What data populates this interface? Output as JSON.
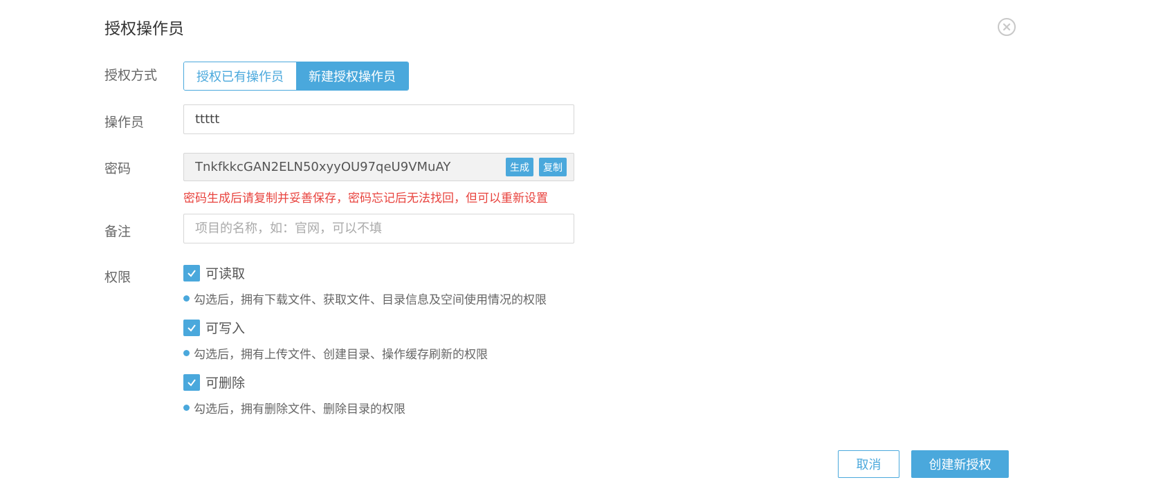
{
  "dialog": {
    "title": "授权操作员",
    "close_icon": "close-circle-icon"
  },
  "auth_mode": {
    "label": "授权方式",
    "options": [
      "授权已有操作员",
      "新建授权操作员"
    ],
    "selected": "新建授权操作员"
  },
  "operator": {
    "label": "操作员",
    "value": "ttttt"
  },
  "password": {
    "label": "密码",
    "value": "TnkfkkcGAN2ELN50xyyOU97qeU9VMuAY",
    "generate_label": "生成",
    "copy_label": "复制",
    "warning": "密码生成后请复制并妥善保存，密码忘记后无法找回，但可以重新设置"
  },
  "remark": {
    "label": "备注",
    "placeholder": "项目的名称，如：官网，可以不填",
    "value": ""
  },
  "permissions": {
    "label": "权限",
    "items": [
      {
        "label": "可读取",
        "checked": true,
        "hint": "勾选后，拥有下载文件、获取文件、目录信息及空间使用情况的权限"
      },
      {
        "label": "可写入",
        "checked": true,
        "hint": "勾选后，拥有上传文件、创建目录、操作缓存刷新的权限"
      },
      {
        "label": "可删除",
        "checked": true,
        "hint": "勾选后，拥有删除文件、删除目录的权限"
      }
    ]
  },
  "footer": {
    "cancel_label": "取消",
    "submit_label": "创建新授权"
  },
  "colors": {
    "accent": "#4aa8dc",
    "warning": "#e8433e"
  }
}
